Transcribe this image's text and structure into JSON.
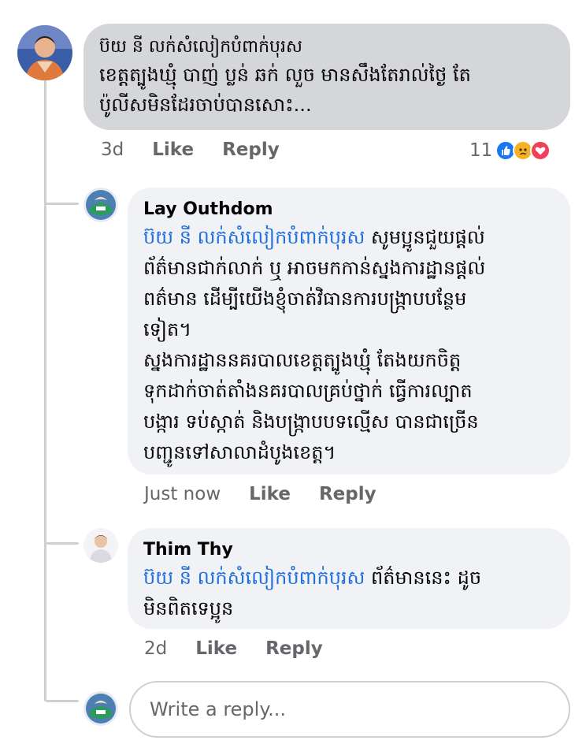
{
  "main_comment": {
    "author": "ប៊យ នី លក់សំលៀកបំពាក់បុរស",
    "line1": "ខេត្តត្បូងឃ្មុំ បាញ់ ប្លន់ ឆក់ លួច មានសឹងតែរាល់ថ្ងៃ តែ",
    "line2": "ប៉ូលីសមិនដែរចាប់បានសោះ...",
    "time": "3d",
    "like_label": "Like",
    "reply_label": "Reply",
    "reaction_count": "11",
    "reactions": [
      "like-icon",
      "sad-icon",
      "love-icon"
    ]
  },
  "replies": [
    {
      "author": "Lay Outhdom",
      "mention": "ប៊យ នី លក់សំលៀកបំពាក់បុរស",
      "line1_rest": " សូមប្អូនជួយផ្ដល់",
      "line2": "ព័ត៌មានជាក់លាក់ ឬ អាចមកកាន់ស្នងការដ្ឋានផ្តល់",
      "line3": "ពត៌មាន ដើម្បីយើងខ្ញុំចាត់វិធានការបង្ក្រាបបន្ថែម",
      "line4": "ទៀត។",
      "line5": "ស្នងការដ្ឋាននគរបាលខេត្តត្បូងឃ្មុំ តែងយកចិត្ត",
      "line6": "ទុកដាក់ចាត់តាំងនគរបាលគ្រប់ថ្នាក់ ធ្វើការល្បាត",
      "line7": "បង្ការ ទប់ស្កាត់ និងបង្ក្រាបបទល្មើស បានជាច្រើន",
      "line8": "បញ្ជូនទៅសាលាដំបូងខេត្ត។",
      "time": "Just now",
      "like_label": "Like",
      "reply_label": "Reply"
    },
    {
      "author": "Thim Thy",
      "mention": "ប៊យ នី លក់សំលៀកបំពាក់បុរស",
      "line1_rest": " ព័ត៌មាននេះ ដូច",
      "line2": "មិនពិតទេប្អូន",
      "time": "2d",
      "like_label": "Like",
      "reply_label": "Reply"
    }
  ],
  "reply_input": {
    "placeholder": "Write a reply..."
  },
  "colors": {
    "mention": "#216fdb",
    "main_bubble": "#d5d6d9",
    "reply_bubble": "#f0f2f5",
    "meta_text": "#65676b",
    "like_reaction": "#1877f2",
    "sad_reaction": "#f7b125",
    "love_reaction": "#f33e58"
  }
}
